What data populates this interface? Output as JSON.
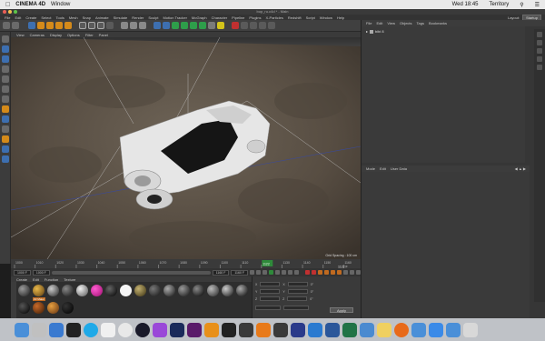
{
  "mac_menubar": {
    "app": "CINEMA 4D",
    "window": "Window",
    "clock": "Wed 18:45",
    "user": "Territory"
  },
  "window_title": "bop_ru.c4d * - Main",
  "app_menu": [
    "File",
    "Edit",
    "Create",
    "Select",
    "Tools",
    "Mesh",
    "Snap",
    "Animate",
    "Simulate",
    "Render",
    "Sculpt",
    "Motion Tracker",
    "MoGraph",
    "Character",
    "Pipeline",
    "Plugins",
    "X-Particles",
    "Redshift",
    "Script",
    "Window",
    "Help"
  ],
  "layout_label": "Layout:",
  "layout_value": "Startup",
  "viewport_menu": [
    "View",
    "Cameras",
    "Display",
    "Options",
    "Filter",
    "Panel"
  ],
  "viewport_grid_info": "Grid Spacing : 100 cm",
  "timeline": {
    "ticks": [
      "1000",
      "1010",
      "1020",
      "1030",
      "1040",
      "1050",
      "1060",
      "1070",
      "1080",
      "1090",
      "1100",
      "1110",
      "1120",
      "1130",
      "1140",
      "1150",
      "1160"
    ],
    "current_frame": "1122",
    "end_label": "1122 F"
  },
  "anim": {
    "start": "1000 F",
    "min": "1000 F",
    "max": "1160 F",
    "end": "1160 F"
  },
  "material_menu": [
    "Create",
    "Edit",
    "Function",
    "Texture"
  ],
  "material_label": "Z2 Mater",
  "coord": {
    "apply": "Apply",
    "labels": [
      "X",
      "Y",
      "Z"
    ],
    "cols": [
      "0 cm",
      "0 cm",
      "0°"
    ]
  },
  "object_menu": [
    "File",
    "Edit",
    "View",
    "Objects",
    "Tags",
    "Bookmarks"
  ],
  "object_item": "bibi 8",
  "attr_menu": [
    "Mode",
    "Edit",
    "User Data"
  ],
  "colors": {
    "menubar": "#e9e9e9",
    "app_bg": "#363636",
    "dock": "#bfc2c7"
  },
  "dock_icons": [
    "finder-icon",
    "launchpad-icon",
    "safari-icon",
    "dashboard-icon",
    "skype-icon",
    "calendar-icon",
    "chrome-icon",
    "cinema4d-icon",
    "after-effects-icon",
    "photoshop-icon",
    "premiere-icon",
    "illustrator-icon",
    "final-cut-icon",
    "davinci-icon",
    "blender-icon",
    "reaper-icon",
    "ps-icon",
    "keynote-icon",
    "word-icon",
    "excel-icon",
    "preview-icon",
    "notes-icon",
    "firefox-icon",
    "finder2-icon",
    "app-store-icon",
    "downloads-icon",
    "trash-icon"
  ]
}
